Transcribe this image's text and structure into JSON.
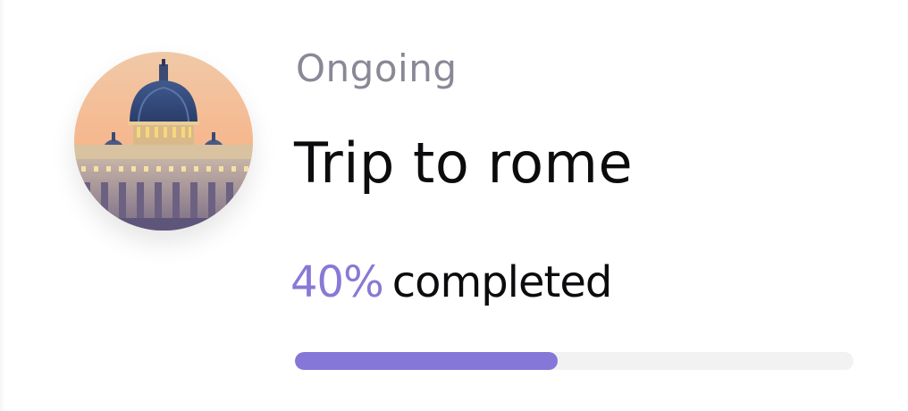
{
  "trip": {
    "status": "Ongoing",
    "title": "Trip to rome",
    "progress_percent_text": "40%",
    "progress_suffix": "completed",
    "progress_fraction": 0.47,
    "image": "rome-dome-photo"
  },
  "colors": {
    "accent": "#8577d8",
    "status_text": "#8a8896",
    "title_text": "#0c0c0f",
    "track": "#f2f2f3"
  }
}
